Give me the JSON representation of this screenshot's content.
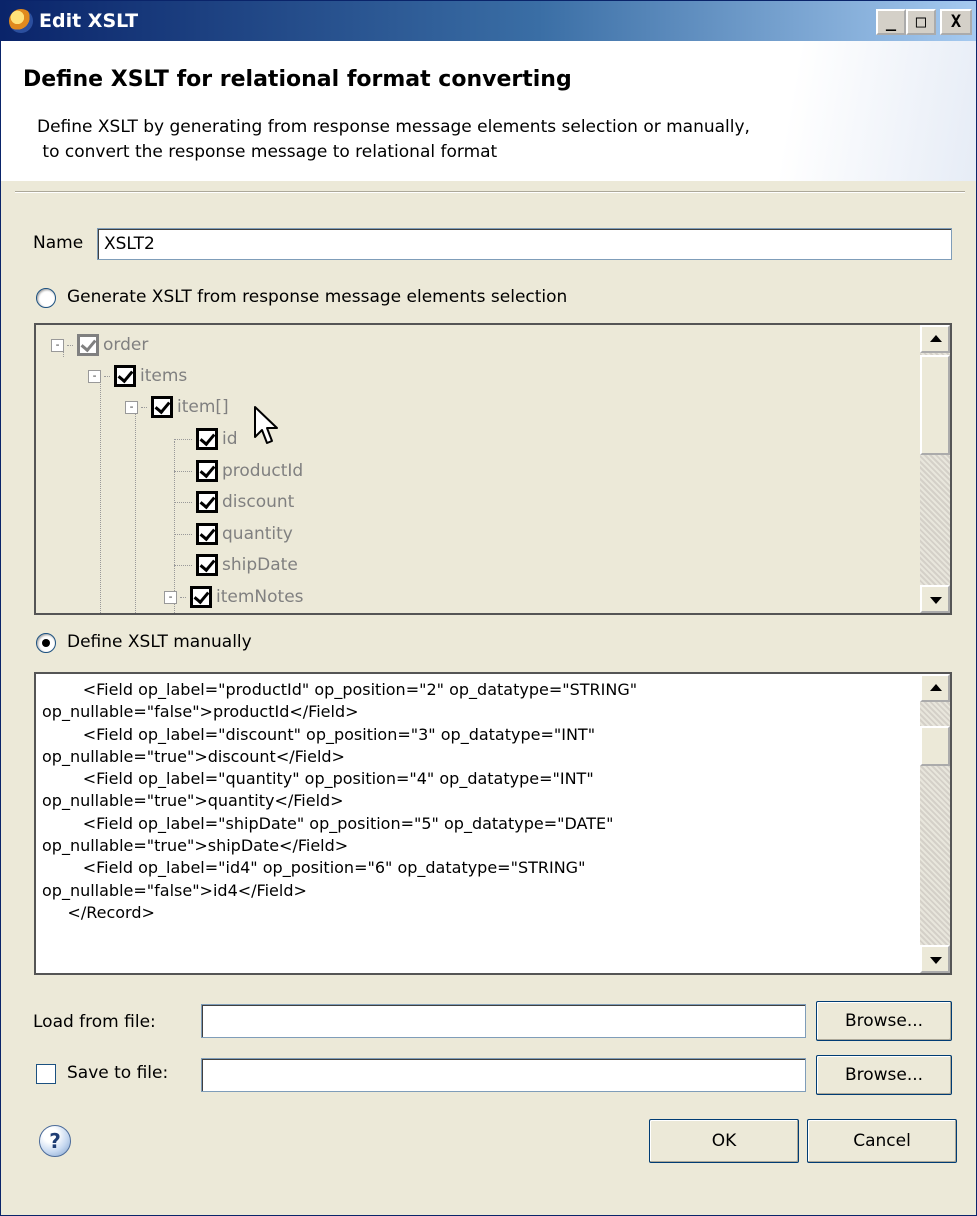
{
  "window": {
    "title": "Edit XSLT",
    "controls": {
      "minimize": "_",
      "maximize": "□",
      "close": "X"
    }
  },
  "header": {
    "title": "Define XSLT for relational format converting",
    "description": "Define XSLT by generating from response message elements selection or manually,\n to convert the response message to relational format"
  },
  "form": {
    "name_label": "Name",
    "name_value": "XSLT2"
  },
  "generate_option": {
    "label": "Generate XSLT from response message elements selection",
    "selected": false
  },
  "tree": {
    "items": [
      {
        "label": "order",
        "expander": "-",
        "checked": true
      },
      {
        "label": "items",
        "expander": "-",
        "checked": true
      },
      {
        "label": "item[]",
        "expander": "-",
        "checked": true
      },
      {
        "label": "id",
        "checked": true
      },
      {
        "label": "productId",
        "checked": true
      },
      {
        "label": "discount",
        "checked": true
      },
      {
        "label": "quantity",
        "checked": true
      },
      {
        "label": "shipDate",
        "checked": true
      },
      {
        "label": "itemNotes",
        "expander": "-",
        "checked": true
      }
    ]
  },
  "manual_option": {
    "label": "Define XSLT manually",
    "selected": true
  },
  "editor": {
    "content": "        <Field op_label=\"productId\" op_position=\"2\" op_datatype=\"STRING\"\nop_nullable=\"false\">productId</Field>\n        <Field op_label=\"discount\" op_position=\"3\" op_datatype=\"INT\"\nop_nullable=\"true\">discount</Field>\n        <Field op_label=\"quantity\" op_position=\"4\" op_datatype=\"INT\"\nop_nullable=\"true\">quantity</Field>\n        <Field op_label=\"shipDate\" op_position=\"5\" op_datatype=\"DATE\"\nop_nullable=\"true\">shipDate</Field>\n        <Field op_label=\"id4\" op_position=\"6\" op_datatype=\"STRING\"\nop_nullable=\"false\">id4</Field>\n     </Record>"
  },
  "load_file": {
    "label": "Load from file:",
    "value": "",
    "browse_label": "Browse..."
  },
  "save_file": {
    "label": "Save to file:",
    "checked": false,
    "value": "",
    "browse_label": "Browse..."
  },
  "footer": {
    "help": "?",
    "ok_label": "OK",
    "cancel_label": "Cancel"
  }
}
